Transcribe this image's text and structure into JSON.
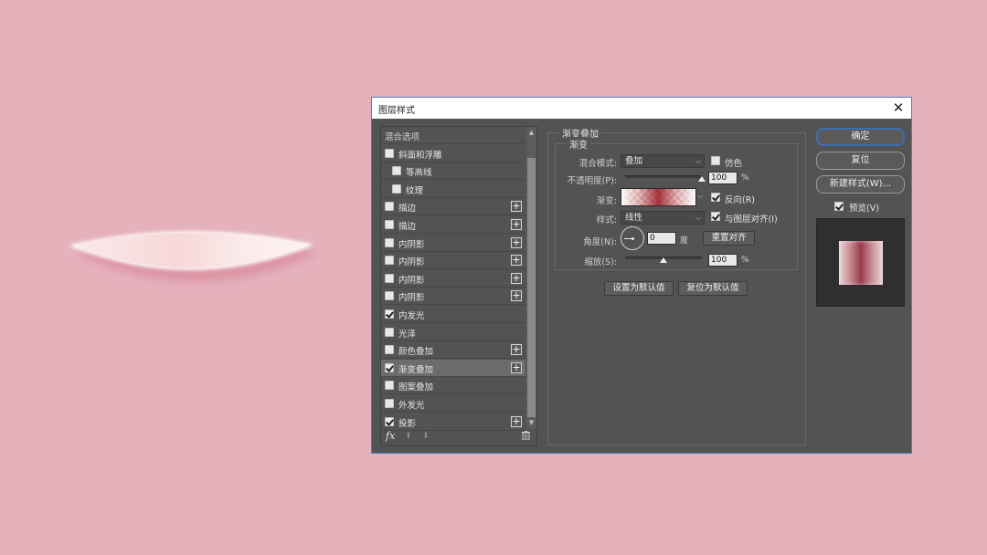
{
  "dialog": {
    "title": "图层样式",
    "close_icon": "close-icon"
  },
  "styles_list": {
    "header": "混合选项",
    "items": [
      {
        "label": "斜面和浮雕",
        "checked": false,
        "indent": false,
        "plus": false
      },
      {
        "label": "等高线",
        "checked": false,
        "indent": true,
        "plus": false
      },
      {
        "label": "纹理",
        "checked": false,
        "indent": true,
        "plus": false
      },
      {
        "label": "描边",
        "checked": false,
        "indent": false,
        "plus": true
      },
      {
        "label": "描边",
        "checked": false,
        "indent": false,
        "plus": true
      },
      {
        "label": "内阴影",
        "checked": false,
        "indent": false,
        "plus": true
      },
      {
        "label": "内阴影",
        "checked": false,
        "indent": false,
        "plus": true
      },
      {
        "label": "内阴影",
        "checked": false,
        "indent": false,
        "plus": true
      },
      {
        "label": "内阴影",
        "checked": false,
        "indent": false,
        "plus": true
      },
      {
        "label": "内发光",
        "checked": true,
        "indent": false,
        "plus": false
      },
      {
        "label": "光泽",
        "checked": false,
        "indent": false,
        "plus": false
      },
      {
        "label": "颜色叠加",
        "checked": false,
        "indent": false,
        "plus": true
      },
      {
        "label": "渐变叠加",
        "checked": true,
        "indent": false,
        "plus": true,
        "selected": true
      },
      {
        "label": "图案叠加",
        "checked": false,
        "indent": false,
        "plus": false
      },
      {
        "label": "外发光",
        "checked": false,
        "indent": false,
        "plus": false
      },
      {
        "label": "投影",
        "checked": true,
        "indent": false,
        "plus": true
      }
    ],
    "fx_label": "fx",
    "move_up_icon": "arrow-up-icon",
    "move_down_icon": "arrow-down-icon",
    "delete_icon": "trash-icon"
  },
  "gradient_overlay": {
    "section_title": "渐变叠加",
    "group_title": "渐变",
    "blend_mode_label": "混合模式:",
    "blend_mode_value": "叠加",
    "dither_label": "仿色",
    "dither_checked": false,
    "opacity_label": "不透明度(P):",
    "opacity_value": "100",
    "opacity_fraction": 1.0,
    "percent": "%",
    "gradient_label": "渐变:",
    "reverse_label": "反向(R)",
    "reverse_checked": true,
    "style_label": "样式:",
    "style_value": "线性",
    "align_label": "与图层对齐(I)",
    "align_checked": true,
    "angle_label": "角度(N):",
    "angle_value": "0",
    "degree_unit": "度",
    "reset_align_button": "重置对齐",
    "scale_label": "缩放(S):",
    "scale_value": "100",
    "scale_fraction": 0.5,
    "set_default_button": "设置为默认值",
    "reset_default_button": "复位为默认值"
  },
  "actions": {
    "ok": "确定",
    "reset": "复位",
    "new_style": "新建样式(W)...",
    "preview_label": "预览(V)",
    "preview_checked": true
  }
}
